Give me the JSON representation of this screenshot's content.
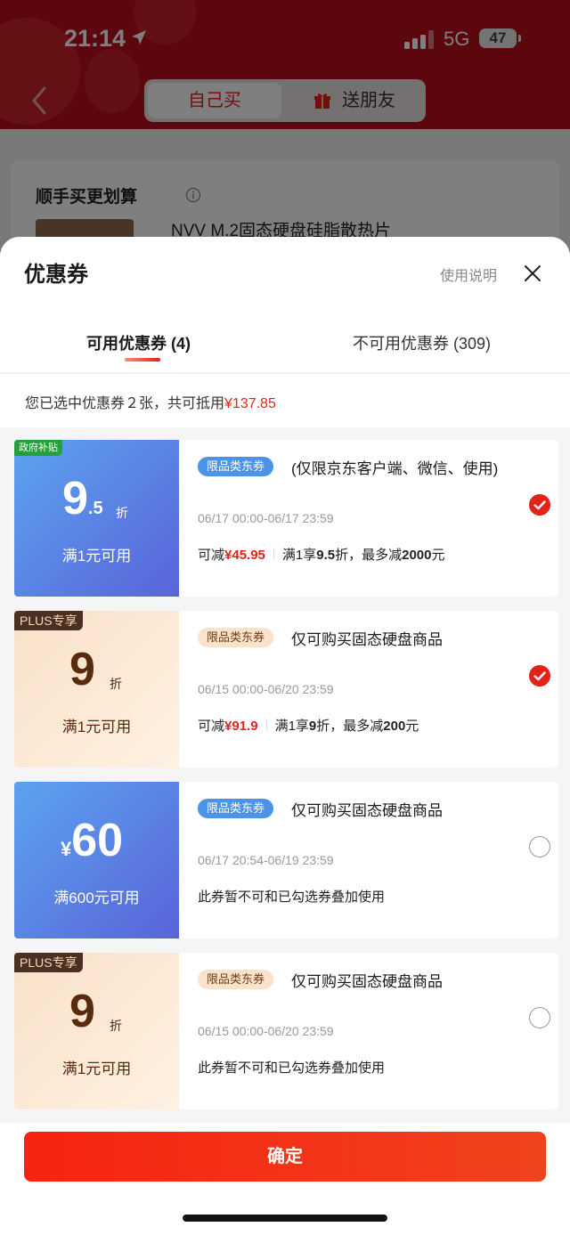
{
  "status": {
    "time": "21:14",
    "network": "5G",
    "battery": "47"
  },
  "header": {
    "tab_self": "自己买",
    "tab_gift": "送朋友"
  },
  "background_card": {
    "title": "顺手买更划算",
    "product": "NVV M.2固态硬盘硅脂散热片"
  },
  "sheet": {
    "title": "优惠券",
    "help": "使用说明",
    "tab_available": "可用优惠券 (4)",
    "tab_unavailable": "不可用优惠券 (309)",
    "summary_prefix": "您已选中优惠券２张，共可抵用",
    "summary_amount": "¥137.85"
  },
  "coupons": [
    {
      "tag": "政府补贴",
      "big": "9",
      "big_small": ".5",
      "unit": "折",
      "condition": "满1元可用",
      "badge": "限品类东券",
      "scope": "(仅限京东客户端、微信、使用)",
      "date": "06/17 00:00-06/17 23:59",
      "detail_prefix": "可减",
      "detail_amount": "¥45.95",
      "detail_rule": "满1享",
      "detail_rule_bold": "9.5",
      "detail_rule_mid": "折，最多减",
      "detail_rule_max": "2000",
      "detail_rule_end": "元",
      "checked": true
    },
    {
      "tag": "PLUS专享",
      "big": "9",
      "unit": "折",
      "condition": "满1元可用",
      "badge": "限品类东券",
      "scope": "仅可购买固态硬盘商品",
      "date": "06/15 00:00-06/20 23:59",
      "detail_prefix": "可减",
      "detail_amount": "¥91.9",
      "detail_rule": "满1享",
      "detail_rule_bold": "9",
      "detail_rule_mid": "折，最多减",
      "detail_rule_max": "200",
      "detail_rule_end": "元",
      "checked": true
    },
    {
      "big_prefix": "¥",
      "big": "60",
      "condition": "满600元可用",
      "badge": "限品类东券",
      "scope": "仅可购买固态硬盘商品",
      "date": "06/17 20:54-06/19 23:59",
      "detail": "此券暂不可和已勾选券叠加使用",
      "checked": false
    },
    {
      "tag": "PLUS专享",
      "big": "9",
      "unit": "折",
      "condition": "满1元可用",
      "badge": "限品类东券",
      "scope": "仅可购买固态硬盘商品",
      "date": "06/15 00:00-06/20 23:59",
      "detail": "此券暂不可和已勾选券叠加使用",
      "checked": false
    }
  ],
  "footer": {
    "confirm": "确定"
  },
  "colors": {
    "accent": "#e2231a",
    "coupon_blue": "#5a7be6",
    "coupon_plus": "#f7e1c9"
  }
}
